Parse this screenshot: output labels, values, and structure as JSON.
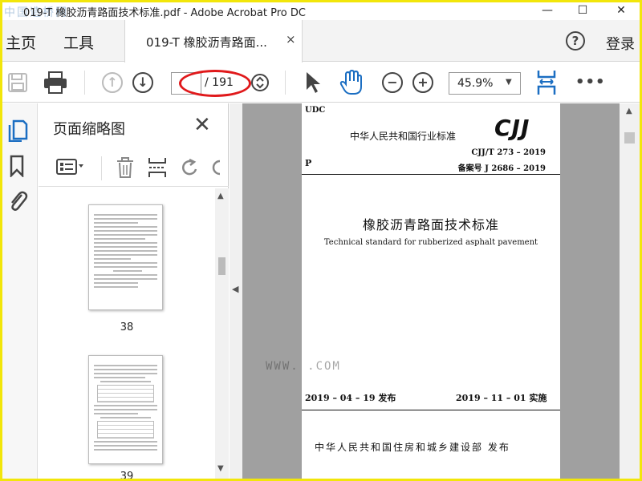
{
  "window": {
    "title": "019-T 橡胶沥青路面技术标准.pdf - Adobe Acrobat Pro DC",
    "watermark_top_left": "中国造桥网",
    "minimize": "—",
    "maximize": "☐",
    "close": "✕"
  },
  "tabs": {
    "home": "主页",
    "tools": "工具",
    "document": "019-T 橡胶沥青路面...",
    "close": "×"
  },
  "header": {
    "help": "?",
    "login": "登录"
  },
  "toolbar": {
    "page_current": "",
    "page_total": "/ 191",
    "zoom": "45.9%",
    "more": "•••"
  },
  "thumbnail_panel": {
    "title": "页面缩略图",
    "close": "✕",
    "thumbnails": [
      {
        "page": "38"
      },
      {
        "page": "39"
      }
    ]
  },
  "document_page": {
    "udc": "UDC",
    "standard_type": "中华人民共和国行业标准",
    "logo": "CJJ",
    "p_label": "P",
    "code": "CJJ/T 273 – 2019",
    "record_no": "备案号 J 2686 – 2019",
    "title_cn": "橡胶沥青路面技术标准",
    "title_en": "Technical standard for rubberized asphalt pavement",
    "issue_date": "2019 – 04 – 19  发布",
    "effective_date": "2019 – 11 – 01  实施",
    "publisher": "中华人民共和国住房和城乡建设部    发布"
  },
  "watermark_bottom": "WWW.      .COM",
  "colors": {
    "frame": "#f2e60a",
    "annotation": "#e0191b",
    "doc_background": "#a0a0a0"
  }
}
